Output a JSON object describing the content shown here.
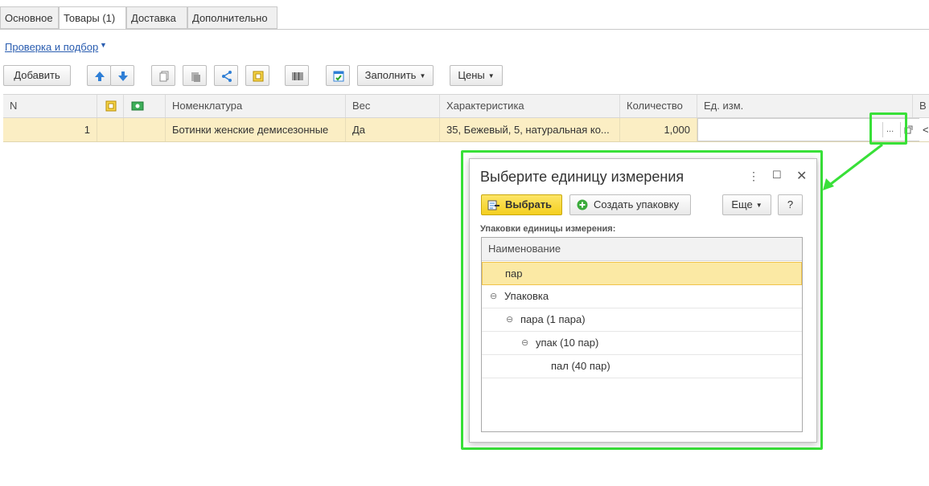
{
  "tabs": [
    {
      "label": "Основное"
    },
    {
      "label": "Товары (1)"
    },
    {
      "label": "Доставка"
    },
    {
      "label": "Дополнительно"
    }
  ],
  "check_link": "Проверка и подбор",
  "toolbar": {
    "add_label": "Добавить",
    "fill_label": "Заполнить",
    "prices_label": "Цены"
  },
  "grid": {
    "headers": {
      "n": "N",
      "nomenclature": "Номенклатура",
      "weight": "Вес",
      "characteristic": "Характеристика",
      "quantity": "Количество",
      "unit": "Ед. изм.",
      "cut": "В"
    },
    "row": {
      "n": "1",
      "nomenclature": "Ботинки женские демисезонные",
      "weight": "Да",
      "characteristic": "35, Бежевый, 5, натуральная ко...",
      "quantity": "1,000",
      "unit": "",
      "ellipsis": "...",
      "cut": "<"
    }
  },
  "dialog": {
    "title": "Выберите единицу измерения",
    "select_label": "Выбрать",
    "create_label": "Создать упаковку",
    "more_label": "Еще",
    "help_label": "?",
    "caption": "Упаковки единицы измерения:",
    "column_header": "Наименование",
    "items": [
      {
        "label": "пар"
      },
      {
        "label": "Упаковка"
      },
      {
        "label": "пара (1 пара)"
      },
      {
        "label": "упак (10 пар)"
      },
      {
        "label": "пал (40 пар)"
      }
    ]
  },
  "colors": {
    "highlight": "#38e038",
    "selected_row": "#fbeec4",
    "primary_button": "#f4cf1f",
    "link": "#2a5db0"
  }
}
